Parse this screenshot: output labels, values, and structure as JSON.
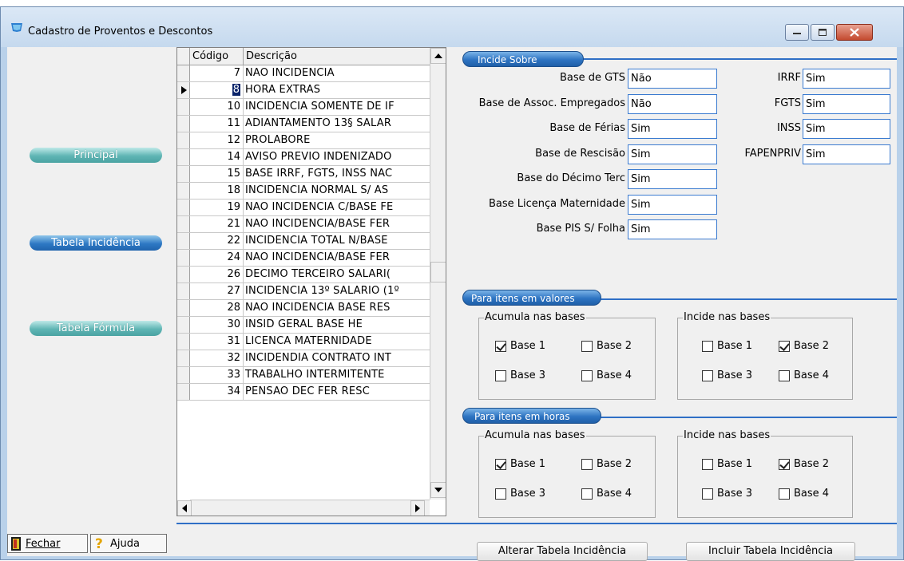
{
  "window": {
    "title": "Cadastro de Proventos e Descontos"
  },
  "nav": {
    "principal": "Principal",
    "tabela_incidencia": "Tabela Incidência",
    "tabela_formula": "Tabela Fórmula"
  },
  "footer": {
    "fechar": "Fechar",
    "ajuda": "Ajuda"
  },
  "grid": {
    "columns": [
      "Código",
      "Descrição"
    ],
    "rows": [
      {
        "code": "7",
        "desc": "NAO INCIDENCIA"
      },
      {
        "code": "8",
        "desc": "HORA EXTRAS"
      },
      {
        "code": "10",
        "desc": "INCIDENCIA SOMENTE DE IF"
      },
      {
        "code": "11",
        "desc": "ADIANTAMENTO 13§ SALAR"
      },
      {
        "code": "12",
        "desc": "PROLABORE"
      },
      {
        "code": "14",
        "desc": "AVISO PREVIO INDENIZADO"
      },
      {
        "code": "15",
        "desc": "BASE IRRF, FGTS, INSS NAC"
      },
      {
        "code": "18",
        "desc": "INCIDENCIA  NORMAL S/ AS"
      },
      {
        "code": "19",
        "desc": "NAO INCIDENCIA C/BASE FE"
      },
      {
        "code": "21",
        "desc": "NAO INCIDENCIA/BASE FER"
      },
      {
        "code": "22",
        "desc": "INCIDENCIA TOTAL  N/BASE"
      },
      {
        "code": "24",
        "desc": "NAO INCIDENCIA/BASE FER"
      },
      {
        "code": "26",
        "desc": "DECIMO TERCEIRO SALARI("
      },
      {
        "code": "27",
        "desc": "INCIDENCIA 13º SALARIO (1º"
      },
      {
        "code": "28",
        "desc": "NAO INCIDENCIA BASE RES"
      },
      {
        "code": "30",
        "desc": "INSID GERAL BASE HE"
      },
      {
        "code": "31",
        "desc": "LICENCA MATERNIDADE"
      },
      {
        "code": "32",
        "desc": "INCIDENDIA CONTRATO INT"
      },
      {
        "code": "33",
        "desc": "TRABALHO INTERMITENTE"
      },
      {
        "code": "34",
        "desc": "PENSAO DEC FER RESC"
      }
    ],
    "selected_code": "8"
  },
  "incide_sobre": {
    "title": "Incide Sobre",
    "left": [
      {
        "label": "Base de GTS",
        "value": "Não"
      },
      {
        "label": "Base de Assoc. Empregados",
        "value": "Não"
      },
      {
        "label": "Base de Férias",
        "value": "Sim"
      },
      {
        "label": "Base de Rescisão",
        "value": "Sim"
      },
      {
        "label": "Base do Décimo Terc",
        "value": "Sim"
      },
      {
        "label": "Base Licença Maternidade",
        "value": "Sim"
      },
      {
        "label": "Base PIS S/ Folha",
        "value": "Sim"
      }
    ],
    "right": [
      {
        "label": "IRRF",
        "value": "Sim"
      },
      {
        "label": "FGTS",
        "value": "Sim"
      },
      {
        "label": "INSS",
        "value": "Sim"
      },
      {
        "label": "FAPENPRIV",
        "value": "Sim"
      }
    ]
  },
  "valores": {
    "title": "Para itens em valores",
    "acumula": {
      "title": "Acumula nas bases",
      "b1": "Base 1",
      "b2": "Base 2",
      "b3": "Base 3",
      "b4": "Base 4",
      "checked": [
        true,
        false,
        false,
        false
      ]
    },
    "incide": {
      "title": "Incide nas bases",
      "b1": "Base 1",
      "b2": "Base 2",
      "b3": "Base 3",
      "b4": "Base 4",
      "checked": [
        false,
        true,
        false,
        false
      ]
    }
  },
  "horas": {
    "title": "Para itens em horas",
    "acumula": {
      "title": "Acumula nas bases",
      "b1": "Base 1",
      "b2": "Base 2",
      "b3": "Base 3",
      "b4": "Base 4",
      "checked": [
        true,
        false,
        false,
        false
      ]
    },
    "incide": {
      "title": "Incide nas bases",
      "b1": "Base 1",
      "b2": "Base 2",
      "b3": "Base 3",
      "b4": "Base 4",
      "checked": [
        false,
        true,
        false,
        false
      ]
    }
  },
  "actions": {
    "alterar": "Alterar Tabela Incidência",
    "incluir": "Incluir Tabela Incidência"
  },
  "colors": {
    "accent": "#2f6fc6",
    "teal": "#5fb5b4",
    "selection": "#0a246a"
  }
}
